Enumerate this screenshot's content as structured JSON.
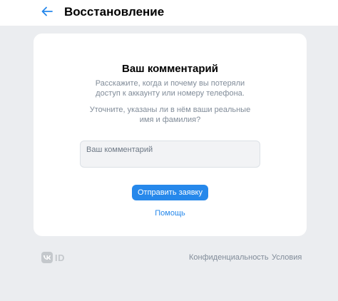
{
  "header": {
    "back_icon": "arrow-left-icon",
    "title": "Восстановление"
  },
  "card": {
    "title": "Ваш комментарий",
    "description_1_line_1": "Расскажите, когда и почему вы потеряли",
    "description_1_line_2": "доступ к аккаунту или номеру телефона.",
    "description_2_line_1": "Уточните, указаны ли в нём ваши реальные",
    "description_2_line_2": "имя и фамилия?",
    "comment_field": {
      "placeholder": "Ваш комментарий",
      "value": ""
    },
    "submit_label": "Отправить заявку",
    "help_label": "Помощь"
  },
  "footer": {
    "logo_icon": "vk-id-logo-icon",
    "logo_text": "ID",
    "privacy_label": "Конфиденциальность",
    "terms_label": "Условия"
  },
  "colors": {
    "accent": "#2688eb",
    "background": "#ebedf0",
    "card": "#ffffff",
    "secondary_text": "#818c99"
  }
}
